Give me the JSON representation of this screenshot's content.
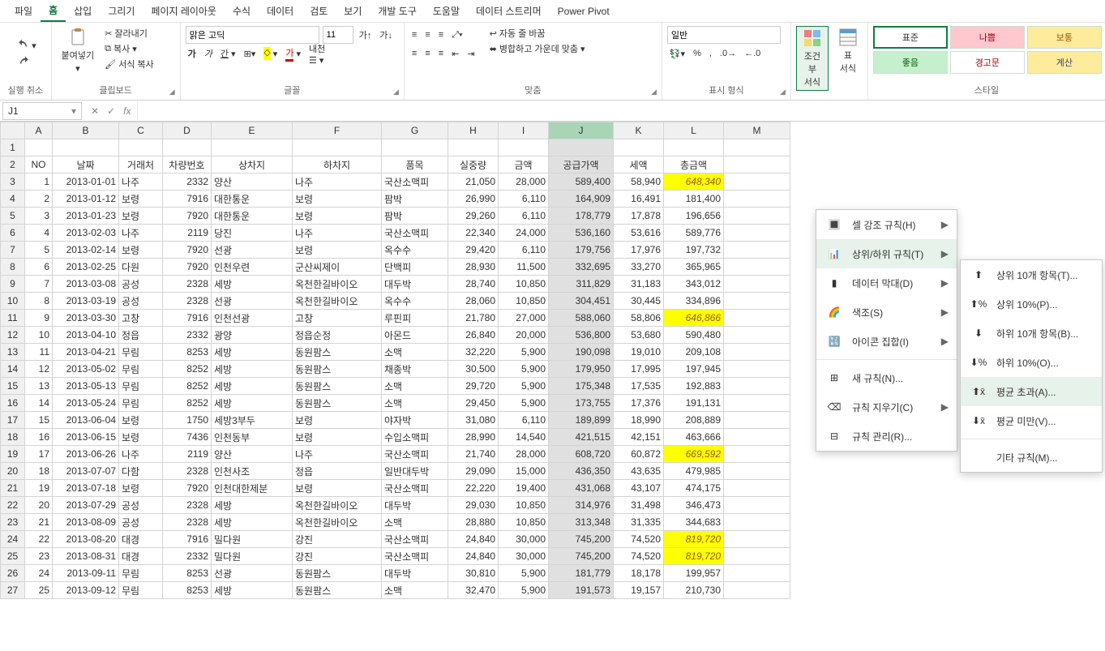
{
  "menubar": {
    "items": [
      "파일",
      "홈",
      "삽입",
      "그리기",
      "페이지 레이아웃",
      "수식",
      "데이터",
      "검토",
      "보기",
      "개발 도구",
      "도움말",
      "데이터 스트리머",
      "Power Pivot"
    ],
    "active": 1
  },
  "ribbon": {
    "undo_group": "실행 취소",
    "clipboard": {
      "paste": "붙여넣기",
      "cut": "잘라내기",
      "copy": "복사",
      "fmtpaint": "서식 복사",
      "label": "클립보드"
    },
    "font": {
      "name": "맑은 고딕",
      "size": "11",
      "inc": "가",
      "dec": "가",
      "label": "글꼴"
    },
    "align": {
      "wrap": "자동 줄 바꿈",
      "merge": "병합하고 가운데 맞춤",
      "label": "맞춤"
    },
    "number": {
      "fmt": "일반",
      "label": "표시 형식"
    },
    "cond": {
      "cond": "조건부\n서식",
      "table": "표\n서식",
      "label": "스타일"
    },
    "styles": {
      "normal": "표준",
      "bad": "나쁨",
      "neutral": "보통",
      "good": "좋음",
      "warn": "경고문",
      "calc": "계산"
    }
  },
  "namebox": "J1",
  "cond_menu": {
    "hcr": "셀 강조 규칙(H)",
    "tbr": "상위/하위 규칙(T)",
    "db": "데이터 막대(D)",
    "cs": "색조(S)",
    "is": "아이콘 집합(I)",
    "new": "새 규칙(N)...",
    "clear": "규칙 지우기(C)",
    "manage": "규칙 관리(R)..."
  },
  "tb_menu": {
    "t10i": "상위 10개 항목(T)...",
    "t10p": "상위 10%(P)...",
    "b10i": "하위 10개 항목(B)...",
    "b10p": "하위 10%(O)...",
    "above": "평균 초과(A)...",
    "below": "평균 미만(V)...",
    "more": "기타 규칙(M)..."
  },
  "columns": [
    "A",
    "B",
    "C",
    "D",
    "E",
    "F",
    "G",
    "H",
    "I",
    "J",
    "K",
    "L",
    "M"
  ],
  "headers": [
    "NO",
    "날짜",
    "거래처",
    "차량번호",
    "상차지",
    "하차지",
    "품목",
    "실중량",
    "금액",
    "공급가액",
    "세액",
    "총금액"
  ],
  "rows": [
    {
      "no": 1,
      "d": "2013-01-01",
      "c": "나주",
      "v": 2332,
      "f": "양산",
      "t": "나주",
      "p": "국산소맥피",
      "w": "21,050",
      "a": "28,000",
      "s": "589,400",
      "x": "58,940",
      "tot": "648,340",
      "hl": true
    },
    {
      "no": 2,
      "d": "2013-01-12",
      "c": "보령",
      "v": 7916,
      "f": "대한통운",
      "t": "보령",
      "p": "팜박",
      "w": "26,990",
      "a": "6,110",
      "s": "164,909",
      "x": "16,491",
      "tot": "181,400"
    },
    {
      "no": 3,
      "d": "2013-01-23",
      "c": "보령",
      "v": 7920,
      "f": "대한통운",
      "t": "보령",
      "p": "팜박",
      "w": "29,260",
      "a": "6,110",
      "s": "178,779",
      "x": "17,878",
      "tot": "196,656"
    },
    {
      "no": 4,
      "d": "2013-02-03",
      "c": "나주",
      "v": 2119,
      "f": "당진",
      "t": "나주",
      "p": "국산소맥피",
      "w": "22,340",
      "a": "24,000",
      "s": "536,160",
      "x": "53,616",
      "tot": "589,776"
    },
    {
      "no": 5,
      "d": "2013-02-14",
      "c": "보령",
      "v": 7920,
      "f": "선광",
      "t": "보령",
      "p": "옥수수",
      "w": "29,420",
      "a": "6,110",
      "s": "179,756",
      "x": "17,976",
      "tot": "197,732"
    },
    {
      "no": 6,
      "d": "2013-02-25",
      "c": "다원",
      "v": 7920,
      "f": "인천우련",
      "t": "군산씨제이",
      "p": "단백피",
      "w": "28,930",
      "a": "11,500",
      "s": "332,695",
      "x": "33,270",
      "tot": "365,965"
    },
    {
      "no": 7,
      "d": "2013-03-08",
      "c": "공성",
      "v": 2328,
      "f": "세방",
      "t": "옥천한길바이오",
      "p": "대두박",
      "w": "28,740",
      "a": "10,850",
      "s": "311,829",
      "x": "31,183",
      "tot": "343,012"
    },
    {
      "no": 8,
      "d": "2013-03-19",
      "c": "공성",
      "v": 2328,
      "f": "선광",
      "t": "옥천한길바이오",
      "p": "옥수수",
      "w": "28,060",
      "a": "10,850",
      "s": "304,451",
      "x": "30,445",
      "tot": "334,896"
    },
    {
      "no": 9,
      "d": "2013-03-30",
      "c": "고창",
      "v": 7916,
      "f": "인천선광",
      "t": "고창",
      "p": "루핀피",
      "w": "21,780",
      "a": "27,000",
      "s": "588,060",
      "x": "58,806",
      "tot": "646,866",
      "hl": true
    },
    {
      "no": 10,
      "d": "2013-04-10",
      "c": "정읍",
      "v": 2332,
      "f": "광양",
      "t": "정읍순정",
      "p": "아몬드",
      "w": "26,840",
      "a": "20,000",
      "s": "536,800",
      "x": "53,680",
      "tot": "590,480"
    },
    {
      "no": 11,
      "d": "2013-04-21",
      "c": "무림",
      "v": 8253,
      "f": "세방",
      "t": "동원팜스",
      "p": "소맥",
      "w": "32,220",
      "a": "5,900",
      "s": "190,098",
      "x": "19,010",
      "tot": "209,108"
    },
    {
      "no": 12,
      "d": "2013-05-02",
      "c": "무림",
      "v": 8252,
      "f": "세방",
      "t": "동원팜스",
      "p": "채종박",
      "w": "30,500",
      "a": "5,900",
      "s": "179,950",
      "x": "17,995",
      "tot": "197,945"
    },
    {
      "no": 13,
      "d": "2013-05-13",
      "c": "무림",
      "v": 8252,
      "f": "세방",
      "t": "동원팜스",
      "p": "소맥",
      "w": "29,720",
      "a": "5,900",
      "s": "175,348",
      "x": "17,535",
      "tot": "192,883"
    },
    {
      "no": 14,
      "d": "2013-05-24",
      "c": "무림",
      "v": 8252,
      "f": "세방",
      "t": "동원팜스",
      "p": "소맥",
      "w": "29,450",
      "a": "5,900",
      "s": "173,755",
      "x": "17,376",
      "tot": "191,131"
    },
    {
      "no": 15,
      "d": "2013-06-04",
      "c": "보령",
      "v": 1750,
      "f": "세방3부두",
      "t": "보령",
      "p": "야자박",
      "w": "31,080",
      "a": "6,110",
      "s": "189,899",
      "x": "18,990",
      "tot": "208,889"
    },
    {
      "no": 16,
      "d": "2013-06-15",
      "c": "보령",
      "v": 7436,
      "f": "인천동부",
      "t": "보령",
      "p": "수입소맥피",
      "w": "28,990",
      "a": "14,540",
      "s": "421,515",
      "x": "42,151",
      "tot": "463,666"
    },
    {
      "no": 17,
      "d": "2013-06-26",
      "c": "나주",
      "v": 2119,
      "f": "양산",
      "t": "나주",
      "p": "국산소맥피",
      "w": "21,740",
      "a": "28,000",
      "s": "608,720",
      "x": "60,872",
      "tot": "669,592",
      "hl": true
    },
    {
      "no": 18,
      "d": "2013-07-07",
      "c": "다함",
      "v": 2328,
      "f": "인천사조",
      "t": "정읍",
      "p": "일반대두박",
      "w": "29,090",
      "a": "15,000",
      "s": "436,350",
      "x": "43,635",
      "tot": "479,985"
    },
    {
      "no": 19,
      "d": "2013-07-18",
      "c": "보령",
      "v": 7920,
      "f": "인천대한제분",
      "t": "보령",
      "p": "국산소맥피",
      "w": "22,220",
      "a": "19,400",
      "s": "431,068",
      "x": "43,107",
      "tot": "474,175"
    },
    {
      "no": 20,
      "d": "2013-07-29",
      "c": "공성",
      "v": 2328,
      "f": "세방",
      "t": "옥천한길바이오",
      "p": "대두박",
      "w": "29,030",
      "a": "10,850",
      "s": "314,976",
      "x": "31,498",
      "tot": "346,473"
    },
    {
      "no": 21,
      "d": "2013-08-09",
      "c": "공성",
      "v": 2328,
      "f": "세방",
      "t": "옥천한길바이오",
      "p": "소맥",
      "w": "28,880",
      "a": "10,850",
      "s": "313,348",
      "x": "31,335",
      "tot": "344,683"
    },
    {
      "no": 22,
      "d": "2013-08-20",
      "c": "대경",
      "v": 7916,
      "f": "밀다원",
      "t": "강진",
      "p": "국산소맥피",
      "w": "24,840",
      "a": "30,000",
      "s": "745,200",
      "x": "74,520",
      "tot": "819,720",
      "hl": true
    },
    {
      "no": 23,
      "d": "2013-08-31",
      "c": "대경",
      "v": 2332,
      "f": "밀다원",
      "t": "강진",
      "p": "국산소맥피",
      "w": "24,840",
      "a": "30,000",
      "s": "745,200",
      "x": "74,520",
      "tot": "819,720",
      "hl": true
    },
    {
      "no": 24,
      "d": "2013-09-11",
      "c": "무림",
      "v": 8253,
      "f": "선광",
      "t": "동원팜스",
      "p": "대두박",
      "w": "30,810",
      "a": "5,900",
      "s": "181,779",
      "x": "18,178",
      "tot": "199,957"
    },
    {
      "no": 25,
      "d": "2013-09-12",
      "c": "무림",
      "v": 8253,
      "f": "세방",
      "t": "동원팜스",
      "p": "소맥",
      "w": "32,470",
      "a": "5,900",
      "s": "191,573",
      "x": "19,157",
      "tot": "210,730"
    }
  ]
}
